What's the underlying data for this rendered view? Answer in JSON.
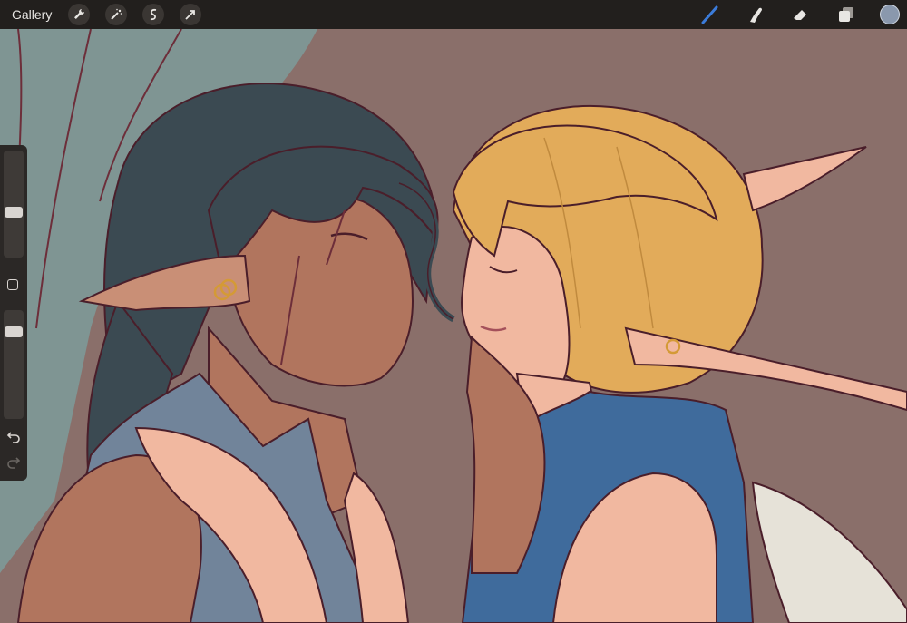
{
  "toolbar": {
    "gallery_label": "Gallery",
    "left_tools": [
      "wrench-icon",
      "magic-wand-icon",
      "selection-icon",
      "transform-arrow-icon"
    ],
    "right_tools": [
      "brush-icon",
      "smudge-icon",
      "eraser-icon",
      "layers-icon"
    ],
    "current_color": "#8a98ad",
    "active_tool_color": "#3b7bd9"
  },
  "sidebar": {
    "brush_size_level": 0.6,
    "opacity_level": 0.8
  },
  "canvas": {
    "background_color": "#8a6f6a"
  }
}
